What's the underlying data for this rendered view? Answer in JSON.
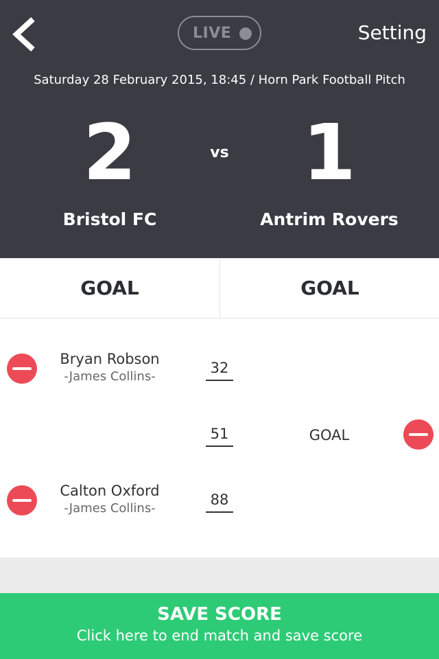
{
  "header": {
    "back_icon": "chevron-left-icon",
    "live_label": "LIVE",
    "setting_label": "Setting",
    "match_info": "Saturday 28 February 2015, 18:45 / Horn Park Football Pitch",
    "home_score": "2",
    "away_score": "1",
    "vs_label": "vs",
    "home_team": "Bristol FC",
    "away_team": "Antrim Rovers"
  },
  "goal_buttons": {
    "home_label": "GOAL",
    "away_label": "GOAL"
  },
  "events": [
    {
      "side": "home",
      "scorer": "Bryan Robson",
      "assist": "-James Collins-",
      "minute": "32"
    },
    {
      "side": "away",
      "label": "GOAL",
      "minute": "51"
    },
    {
      "side": "home",
      "scorer": "Calton Oxford",
      "assist": "-James Collins-",
      "minute": "88"
    }
  ],
  "footer": {
    "save_title": "SAVE SCORE",
    "save_subtitle": "Click here to end match and save score"
  },
  "colors": {
    "header_bg": "#3a3b43",
    "remove_red": "#ed4a57",
    "save_green": "#2ecb77",
    "live_gray": "#8c8d94"
  }
}
